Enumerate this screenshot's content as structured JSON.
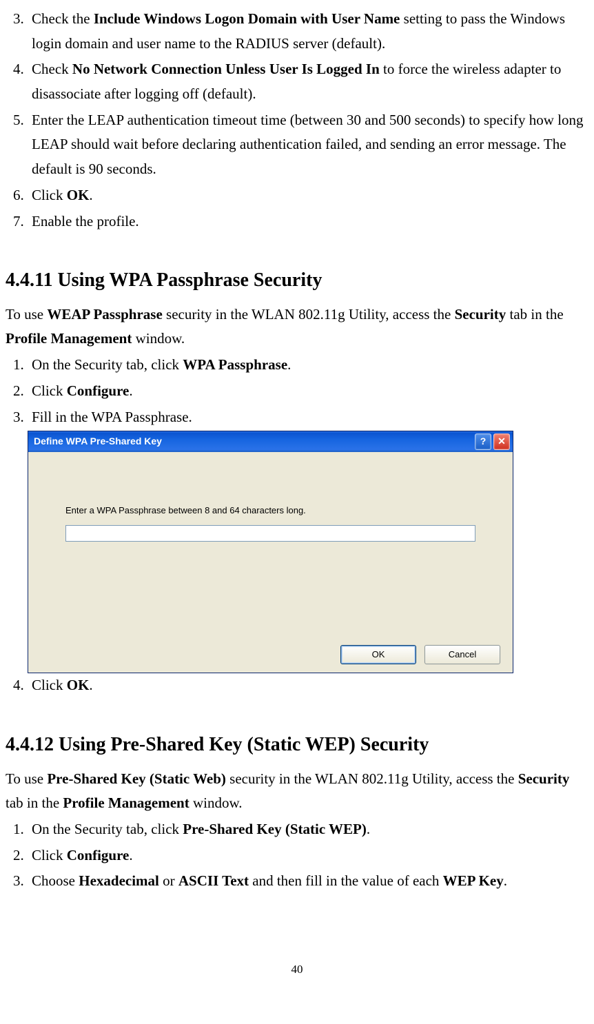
{
  "section_a": {
    "list_start": 3,
    "items": [
      {
        "pre": "Check the ",
        "bold": "Include Windows Logon Domain with User Name",
        "post": " setting to pass the Windows login domain and user name to the RADIUS server (default)."
      },
      {
        "pre": "Check ",
        "bold": "No Network Connection Unless User Is Logged In",
        "post": " to force the wireless adapter to disassociate after logging off (default)."
      },
      {
        "text": "Enter the LEAP authentication timeout time (between 30 and 500 seconds) to specify how long LEAP should wait before declaring authentication failed, and sending an error message. The default is 90 seconds."
      },
      {
        "pre": "Click ",
        "bold": "OK",
        "post": "."
      },
      {
        "text": "Enable the profile."
      }
    ]
  },
  "section_b": {
    "heading": "4.4.11 Using WPA Passphrase Security",
    "intro": {
      "parts": [
        {
          "t": "To use "
        },
        {
          "b": "WEAP Passphrase"
        },
        {
          "t": " security in the WLAN 802.11g Utility, access the "
        },
        {
          "b": "Security"
        },
        {
          "t": " tab in the "
        },
        {
          "b": "Profile Management"
        },
        {
          "t": " window."
        }
      ]
    },
    "list_start": 1,
    "items": [
      {
        "pre": "On the Security tab, click ",
        "bold": "WPA Passphrase",
        "post": "."
      },
      {
        "pre": "Click ",
        "bold": "Configure",
        "post": "."
      },
      {
        "text": "Fill in the WPA Passphrase."
      },
      {
        "pre": "Click ",
        "bold": "OK",
        "post": "."
      }
    ]
  },
  "dialog": {
    "title": "Define WPA Pre-Shared Key",
    "instruction": "Enter a WPA Passphrase between 8 and 64 characters long.",
    "input_value": "",
    "ok": "OK",
    "cancel": "Cancel",
    "help_glyph": "?",
    "close_glyph": "✕"
  },
  "section_c": {
    "heading": "4.4.12 Using Pre-Shared Key (Static WEP) Security",
    "intro": {
      "parts": [
        {
          "t": "To use "
        },
        {
          "b": "Pre-Shared Key (Static Web)"
        },
        {
          "t": " security in the WLAN 802.11g Utility, access the "
        },
        {
          "b": "Security"
        },
        {
          "t": " tab in the "
        },
        {
          "b": "Profile Management"
        },
        {
          "t": " window."
        }
      ]
    },
    "list_start": 1,
    "items": [
      {
        "pre": "On the Security tab, click ",
        "bold": "Pre-Shared Key (Static WEP)",
        "post": "."
      },
      {
        "pre": "Click ",
        "bold": "Configure",
        "post": "."
      },
      {
        "parts": [
          {
            "t": "Choose "
          },
          {
            "b": "Hexadecimal"
          },
          {
            "t": " or "
          },
          {
            "b": "ASCII Text"
          },
          {
            "t": " and then fill in the value of each "
          },
          {
            "b": "WEP Key"
          },
          {
            "t": "."
          }
        ]
      }
    ]
  },
  "page_number": "40"
}
